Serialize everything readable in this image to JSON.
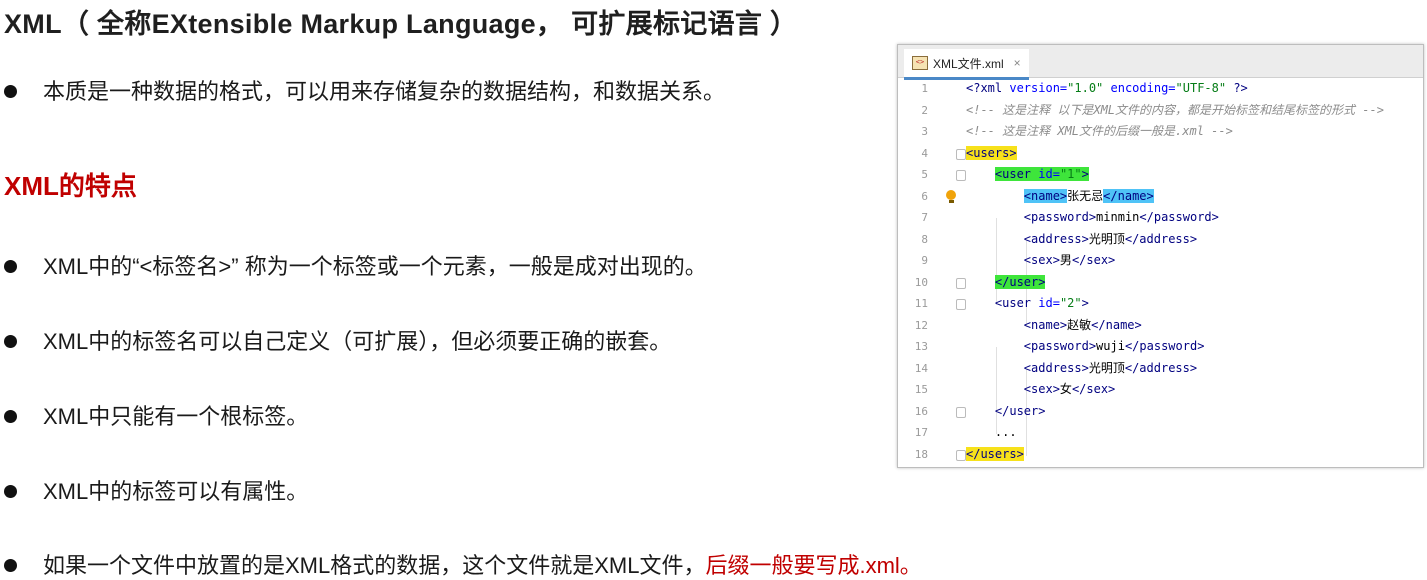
{
  "title": "XML（ 全称EXtensible Markup Language， 可扩展标记语言 ）",
  "intro": "本质是一种数据的格式，可以用来存储复杂的数据结构，和数据关系。",
  "section_title": "XML的特点",
  "bullets": [
    "XML中的“<标签名>” 称为一个标签或一个元素，一般是成对出现的。",
    "XML中的标签名可以自己定义（可扩展），但必须要正确的嵌套。",
    "XML中只能有一个根标签。",
    "XML中的标签可以有属性。"
  ],
  "last_bullet": {
    "prefix": "如果一个文件中放置的是XML格式的数据，这个文件就是XML文件，",
    "accent": "后缀一般要写成.xml。"
  },
  "ide": {
    "tab_label": "XML文件.xml",
    "tab_icon": "xml-file-icon",
    "close_glyph": "×",
    "bulb_icon": "lightbulb-icon",
    "line_numbers": [
      "1",
      "2",
      "3",
      "4",
      "5",
      "6",
      "7",
      "8",
      "9",
      "10",
      "11",
      "12",
      "13",
      "14",
      "15",
      "16",
      "17",
      "18"
    ],
    "lines": {
      "l1": {
        "a": "<?xml ",
        "b": "version=",
        "c": "\"1.0\"",
        "d": " encoding=",
        "e": "\"UTF-8\"",
        "f": " ?>"
      },
      "l2": "<!-- 这是注释 以下是XML文件的内容，都是开始标签和结尾标签的形式 -->",
      "l3": "<!-- 这是注释 XML文件的后缀一般是.xml -->",
      "l4": "<users>",
      "l5": {
        "a": "<user ",
        "b": "id=",
        "c": "\"1\"",
        "d": ">"
      },
      "l6": {
        "a": "<name>",
        "b": "张无忌",
        "c": "</name>"
      },
      "l7": {
        "a": "<password>",
        "b": "minmin",
        "c": "</password>"
      },
      "l8": {
        "a": "<address>",
        "b": "光明顶",
        "c": "</address>"
      },
      "l9": {
        "a": "<sex>",
        "b": "男",
        "c": "</sex>"
      },
      "l10": "</user>",
      "l11": {
        "a": "<user ",
        "b": "id=",
        "c": "\"2\"",
        "d": ">"
      },
      "l12": {
        "a": "<name>",
        "b": "赵敏",
        "c": "</name>"
      },
      "l13": {
        "a": "<password>",
        "b": "wuji",
        "c": "</password>"
      },
      "l14": {
        "a": "<address>",
        "b": "光明顶",
        "c": "</address>"
      },
      "l15": {
        "a": "<sex>",
        "b": "女",
        "c": "</sex>"
      },
      "l16": "</user>",
      "l17": "...",
      "l18": "</users>"
    }
  },
  "colors": {
    "accent": "#c00000",
    "highlight_yellow": "#f7e11a",
    "highlight_green": "#3ee53b",
    "highlight_cyan": "#4fc3f7"
  }
}
